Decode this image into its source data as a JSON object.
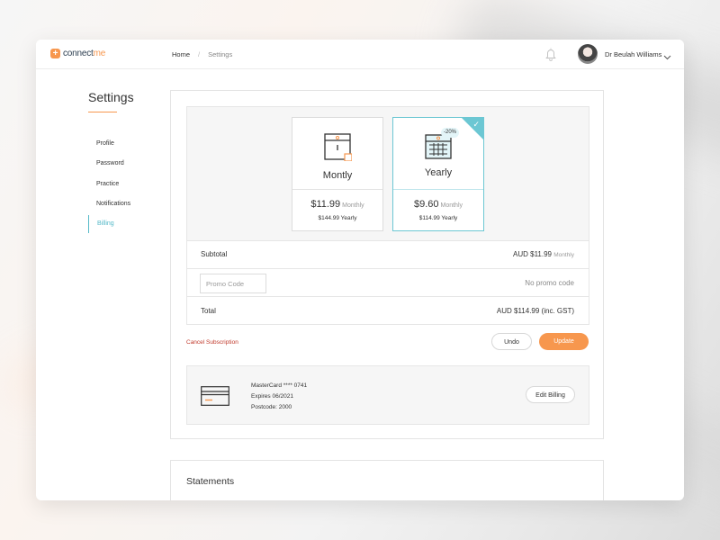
{
  "app": {
    "logo_text": "connect",
    "logo_accent": "me",
    "logo_mark": "+"
  },
  "breadcrumb": {
    "home": "Home",
    "separator": "/",
    "current": "Settings"
  },
  "user": {
    "name": "Dr Beulah Williams"
  },
  "sidebar": {
    "title": "Settings",
    "items": [
      {
        "label": "Profile"
      },
      {
        "label": "Password"
      },
      {
        "label": "Practice"
      },
      {
        "label": "Notifications"
      },
      {
        "label": "Billing",
        "active": true
      }
    ]
  },
  "plans": {
    "monthly": {
      "name": "Montly",
      "price": "$11.99",
      "period": "Monthly",
      "yearly": "$144.99 Yearly"
    },
    "yearly": {
      "name": "Yearly",
      "discount": "-20%",
      "price": "$9.60",
      "period": "Monthly",
      "yearly": "$114.99 Yearly",
      "selected": true
    }
  },
  "summary": {
    "subtotal_label": "Subtotal",
    "subtotal_value": "AUD $11.99",
    "subtotal_period": "Monthly",
    "promo_placeholder": "Promo Code",
    "promo_status": "No promo code",
    "total_label": "Total",
    "total_value": "AUD $114.99 (inc. GST)"
  },
  "actions": {
    "cancel": "Cancel Subscription",
    "undo": "Undo",
    "update": "Update"
  },
  "billing": {
    "card": "MasterCard **** 0741",
    "expires": "Expires 06/2021",
    "postcode": "Postcode: 2000",
    "edit": "Edit Billing"
  },
  "statements": {
    "title": "Statements"
  },
  "colors": {
    "accent": "#f7974e",
    "teal": "#6cc7d3",
    "active_link": "#55b9c8",
    "danger": "#c0392b"
  }
}
